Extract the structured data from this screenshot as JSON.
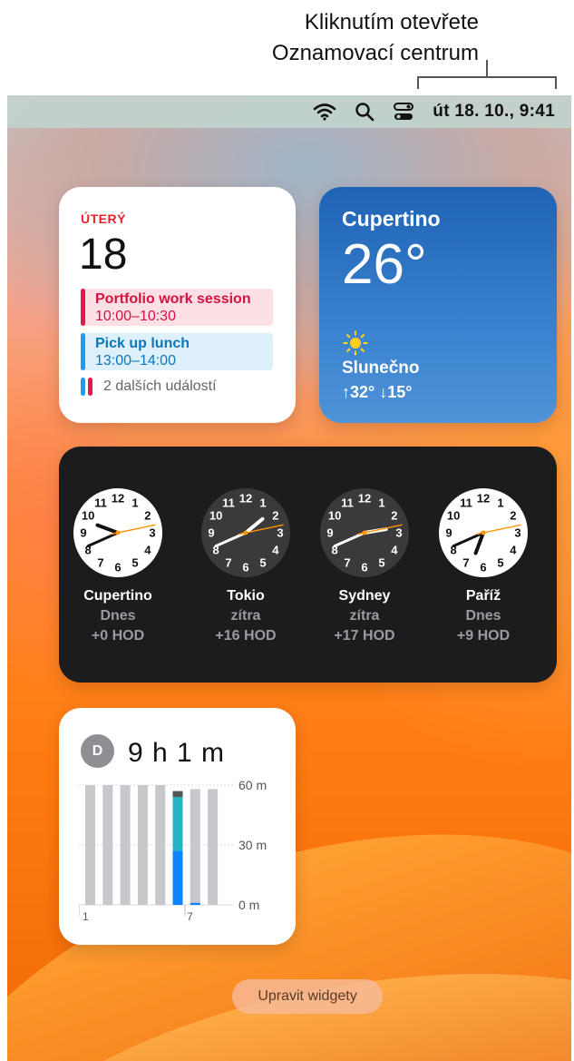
{
  "callout": {
    "line1": "Kliknutím otevřete",
    "line2": "Oznamovací centrum"
  },
  "menubar": {
    "icons": [
      "wifi-icon",
      "search-icon",
      "control-center-icon"
    ],
    "datetime": "út 18. 10.,  9:41"
  },
  "calendar": {
    "weekday": "ÚTERÝ",
    "date": "18",
    "events": [
      {
        "title": "Portfolio work session",
        "time": "10:00–10:30",
        "color": "#e8184a"
      },
      {
        "title": "Pick up lunch",
        "time": "13:00–14:00",
        "color": "#1b9ef0"
      }
    ],
    "more": "2 dalších událostí"
  },
  "weather": {
    "city": "Cupertino",
    "temperature": "26°",
    "condition": "Slunečno",
    "range": "↑32° ↓15°",
    "icon": "sun-icon"
  },
  "world_clock": [
    {
      "city": "Cupertino",
      "day": "Dnes",
      "offset": "+0 HOD",
      "face": "light",
      "time": "9:41"
    },
    {
      "city": "Tokio",
      "day": "zítra",
      "offset": "+16 HOD",
      "face": "dark",
      "time": "1:41"
    },
    {
      "city": "Sydney",
      "day": "zítra",
      "offset": "+17 HOD",
      "face": "dark",
      "time": "2:41"
    },
    {
      "city": "Paříž",
      "day": "Dnes",
      "offset": "+9 HOD",
      "face": "light",
      "time": "18:41"
    }
  ],
  "screen_time": {
    "avatar_letter": "D",
    "total": "9 h 1 m",
    "y_labels": [
      "60 m",
      "30 m",
      "0 m"
    ],
    "x_labels": [
      "1",
      "7"
    ],
    "chart_data": {
      "type": "bar",
      "unit": "minutes",
      "ylim": [
        0,
        60
      ],
      "bars": [
        {
          "gray": 60
        },
        {
          "gray": 60
        },
        {
          "gray": 60
        },
        {
          "gray": 60
        },
        {
          "gray": 60
        },
        {
          "gray": 57,
          "cyan": 27,
          "blue": 27,
          "dark": 3
        },
        {
          "gray": 58,
          "blue": 1
        },
        {
          "gray": 58
        }
      ],
      "colors": {
        "gray": "#c7c7cc",
        "cyan": "#25b3c7",
        "blue": "#0a84ff",
        "dark": "#555555"
      }
    }
  },
  "edit_button": "Upravit widgety"
}
